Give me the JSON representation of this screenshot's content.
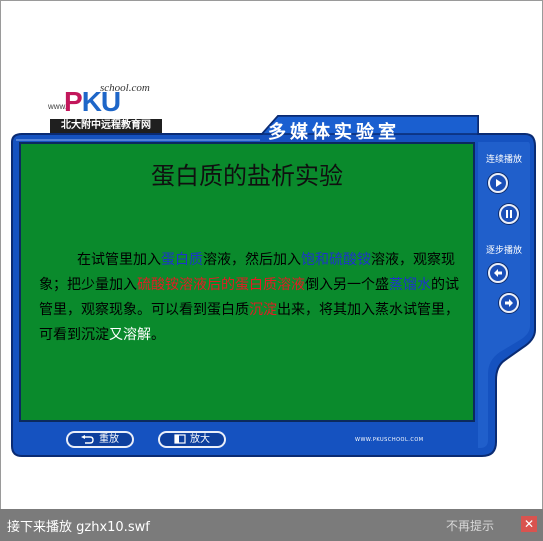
{
  "logo": {
    "school_text": "school.com",
    "www_text": "www.",
    "pku_p": "P",
    "pku_k": "K",
    "pku_u": "U",
    "org_name": "北大附中远程教育网"
  },
  "header": {
    "title": "多媒体实验室"
  },
  "board": {
    "title": "蛋白质的盐析实验",
    "paragraph": [
      {
        "text": "在试管里加入",
        "color": "default"
      },
      {
        "text": "蛋白质",
        "color": "blue"
      },
      {
        "text": "溶液，然后加入",
        "color": "default"
      },
      {
        "text": "饱和硫酸铵",
        "color": "blue"
      },
      {
        "text": "溶液，观察现象；把少量加入",
        "color": "default"
      },
      {
        "text": "硫酸铵溶液后的蛋白质溶液",
        "color": "red"
      },
      {
        "text": "倒入另一个盛",
        "color": "default"
      },
      {
        "text": "蒸馏水",
        "color": "blue"
      },
      {
        "text": "的试管里，观察现象。可以看到蛋白质",
        "color": "default"
      },
      {
        "text": "沉淀",
        "color": "red"
      },
      {
        "text": "出来，将其加入蒸水试管里，可看到沉淀",
        "color": "default"
      },
      {
        "text": "又溶解",
        "color": "white"
      },
      {
        "text": "。",
        "color": "default"
      }
    ]
  },
  "controls": {
    "continuous_label": "连续播放",
    "step_label": "逐步播放",
    "replay_label": "重放",
    "zoom_label": "放大"
  },
  "footer": {
    "url": "WWW.PKUSCHOOL.COM"
  },
  "notice": {
    "text": "接下来播放 gzhx10.swf",
    "dismiss": "不再提示",
    "close": "✕"
  },
  "colors": {
    "panel_blue": "#1552c0",
    "board_green": "#0a8a2c",
    "highlight_blue": "#1d35c9",
    "highlight_red": "#e31b23",
    "notice_bg": "#7b7b7b",
    "close_red": "#d9534f"
  }
}
